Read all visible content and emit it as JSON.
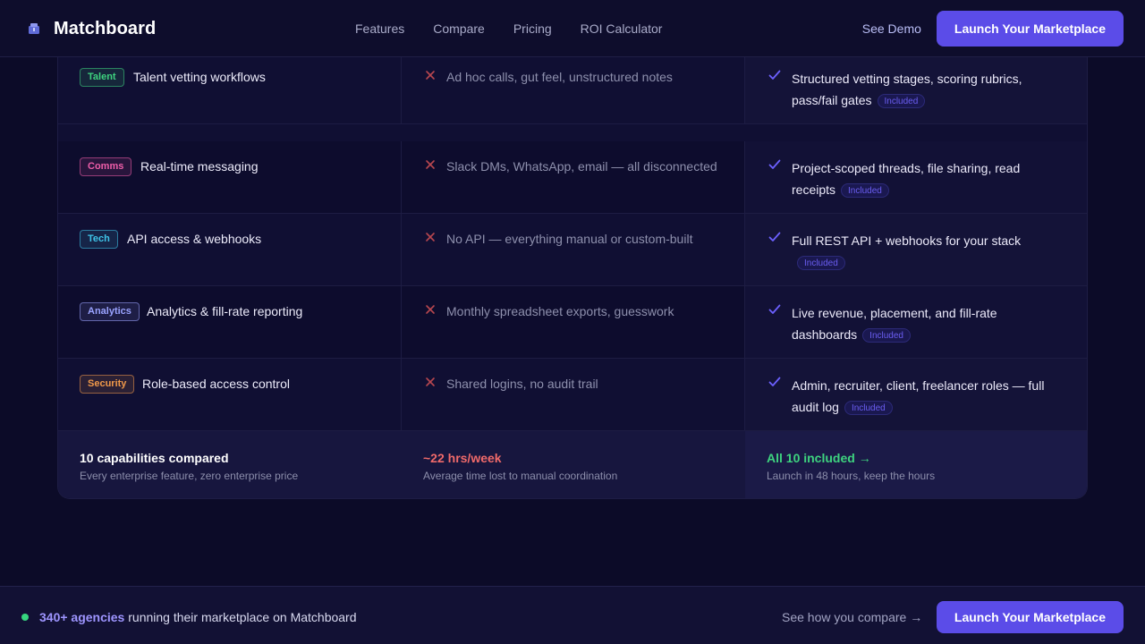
{
  "nav": {
    "brand": "Matchboard",
    "links": [
      "Features",
      "Compare",
      "Pricing",
      "ROI Calculator"
    ],
    "see_demo": "See Demo",
    "cta": "Launch Your Marketplace"
  },
  "colors": {
    "accent": "#5b4ce8",
    "positive": "#3ed37f",
    "negative": "#f06a6a",
    "check": "#6c60ff",
    "cross": "#b8474f"
  },
  "rows": [
    {
      "tag": "Talent",
      "tag_color": "#3ed37f",
      "feature": "Talent vetting workflows",
      "without": "Ad hoc calls, gut feel, unstructured notes",
      "with": "Structured vetting stages, scoring rubrics, pass/fail gates",
      "badge": "Included"
    },
    {
      "tag": "Comms",
      "tag_color": "#ee5ea9",
      "feature": "Real-time messaging",
      "without": "Slack DMs, WhatsApp, email — all disconnected",
      "with": "Project-scoped threads, file sharing, read receipts",
      "badge": "Included"
    },
    {
      "tag": "Tech",
      "tag_color": "#3fc4e8",
      "feature": "API access & webhooks",
      "without": "No API — everything manual or custom-built",
      "with": "Full REST API + webhooks for your stack",
      "badge": "Included"
    },
    {
      "tag": "Analytics",
      "tag_color": "#9aa3ff",
      "feature": "Analytics & fill-rate reporting",
      "without": "Monthly spreadsheet exports, guesswork",
      "with": "Live revenue, placement, and fill-rate dashboards",
      "badge": "Included"
    },
    {
      "tag": "Security",
      "tag_color": "#f0994a",
      "feature": "Role-based access control",
      "without": "Shared logins, no audit trail",
      "with": "Admin, recruiter, client, freelancer roles — full audit log",
      "badge": "Included"
    }
  ],
  "summary": {
    "total_title": "10 capabilities compared",
    "total_sub": "Every enterprise feature, zero enterprise price",
    "lost_title": "~22 hrs/week",
    "lost_sub": "Average time lost to manual coordination",
    "included_title": "All 10 included →",
    "included_sub": "Launch in 48 hours, keep the hours"
  },
  "bottom": {
    "highlight": "340+ agencies",
    "rest": "running their marketplace on Matchboard",
    "compare_link": "See how you compare →",
    "cta": "Launch Your Marketplace"
  }
}
